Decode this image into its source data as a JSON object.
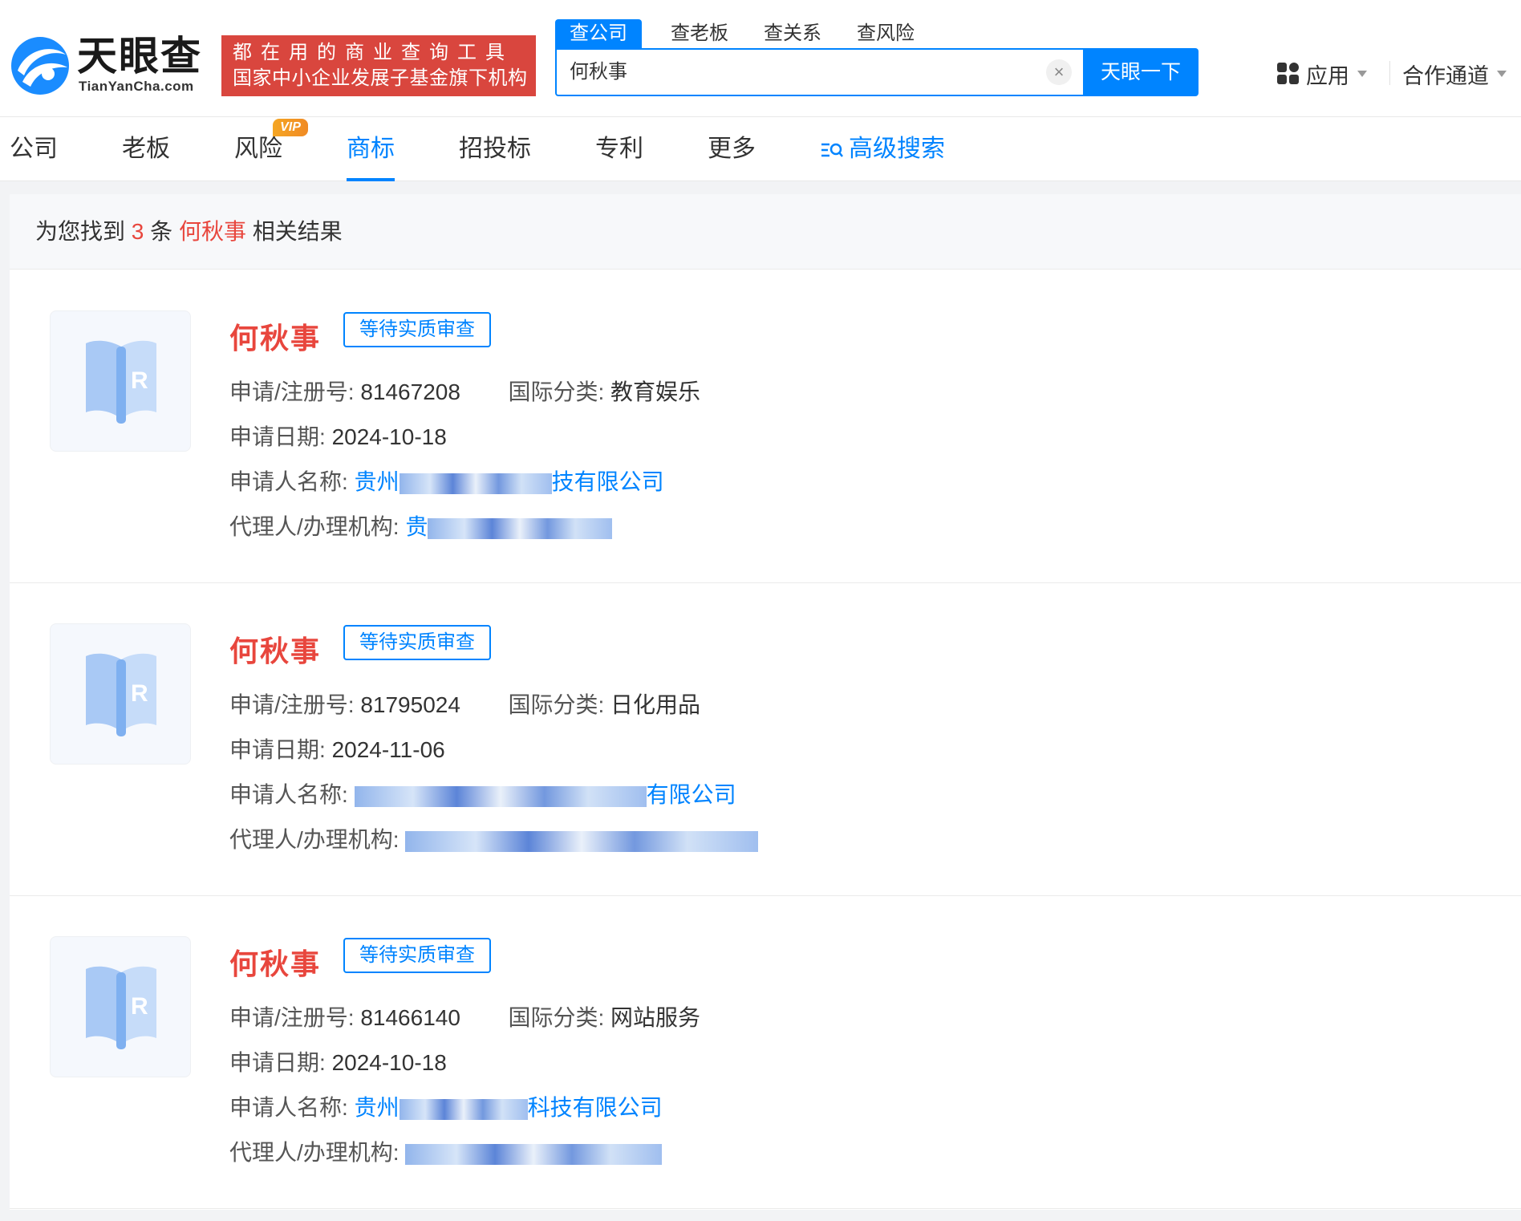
{
  "header": {
    "logo_cn": "天眼查",
    "logo_en": "TianYanCha.com",
    "slogan_line1": "都在用的商业查询工具",
    "slogan_line2": "国家中小企业发展子基金旗下机构",
    "search_tabs": [
      "查公司",
      "查老板",
      "查关系",
      "查风险"
    ],
    "search_value": "何秋事",
    "search_button": "天眼一下",
    "apps_label": "应用",
    "coop_label": "合作通道"
  },
  "categories": {
    "items": [
      "公司",
      "老板",
      "风险",
      "商标",
      "招投标",
      "专利",
      "更多"
    ],
    "active": "商标",
    "vip_badge": "VIP",
    "advanced_search": "高级搜索"
  },
  "summary": {
    "prefix": "为您找到",
    "count": "3",
    "unit": "条",
    "keyword": "何秋事",
    "suffix": "相关结果"
  },
  "labels": {
    "reg_no": "申请/注册号:",
    "intl_class": "国际分类:",
    "apply_date": "申请日期:",
    "applicant": "申请人名称:",
    "agent": "代理人/办理机构:"
  },
  "results": [
    {
      "name": "何秋事",
      "status": "等待实质审查",
      "reg_no": "81467208",
      "intl_class": "教育娱乐",
      "apply_date": "2024-10-18",
      "applicant_visible": "贵州",
      "applicant_tail": "技有限公司",
      "agent_visible": "贵"
    },
    {
      "name": "何秋事",
      "status": "等待实质审查",
      "reg_no": "81795024",
      "intl_class": "日化用品",
      "apply_date": "2024-11-06",
      "applicant_visible": "",
      "applicant_tail": "有限公司",
      "agent_visible": ""
    },
    {
      "name": "何秋事",
      "status": "等待实质审查",
      "reg_no": "81466140",
      "intl_class": "网站服务",
      "apply_date": "2024-10-18",
      "applicant_visible": "贵州",
      "applicant_tail": "科技有限公司",
      "agent_visible": ""
    }
  ],
  "colors": {
    "brand_blue": "#0084ff",
    "highlight_red": "#e8463d",
    "slogan_bg": "#d9463e"
  }
}
